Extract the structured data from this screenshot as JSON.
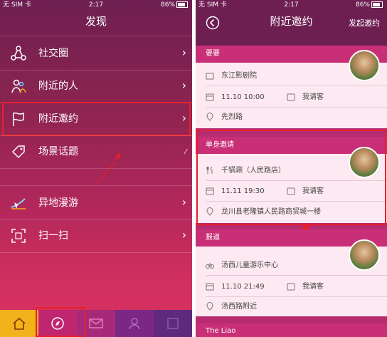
{
  "left": {
    "status": {
      "carrier": "无 SIM 卡",
      "time": "2:17",
      "battery": "86%"
    },
    "title": "发现",
    "menu": [
      {
        "label": "社交圈",
        "icon": "network-icon"
      },
      {
        "label": "附近的人",
        "icon": "people-icon"
      },
      {
        "label": "附近邀约",
        "icon": "flag-icon"
      },
      {
        "label": "场景话题",
        "icon": "tag-icon"
      },
      {
        "label": "异地漫游",
        "icon": "plane-icon"
      },
      {
        "label": "扫一扫",
        "icon": "scan-icon"
      }
    ],
    "tabs": [
      "home-icon",
      "compass-icon",
      "mail-icon",
      "profile-icon",
      "more-icon"
    ]
  },
  "right": {
    "status": {
      "carrier": "无 SIM 卡",
      "time": "2:17",
      "battery": "86%"
    },
    "title": "附近邀约",
    "action": "发起邀约",
    "sections": [
      {
        "header": "要要",
        "place": "东江影剧院",
        "time": "11.10 10:00",
        "pay": "我请客",
        "addr": "先烈路"
      },
      {
        "header": "单身邀请",
        "place": "千锅涮（人民路店）",
        "time": "11.11 19:30",
        "pay": "我请客",
        "addr": "龙川县老隆镇人民路商贸城一楼"
      },
      {
        "header": "报道",
        "place": "汤西儿童游乐中心",
        "time": "11.10 21:49",
        "pay": "我请客",
        "addr": "汤西路附近"
      },
      {
        "header": "The Liao"
      }
    ]
  }
}
